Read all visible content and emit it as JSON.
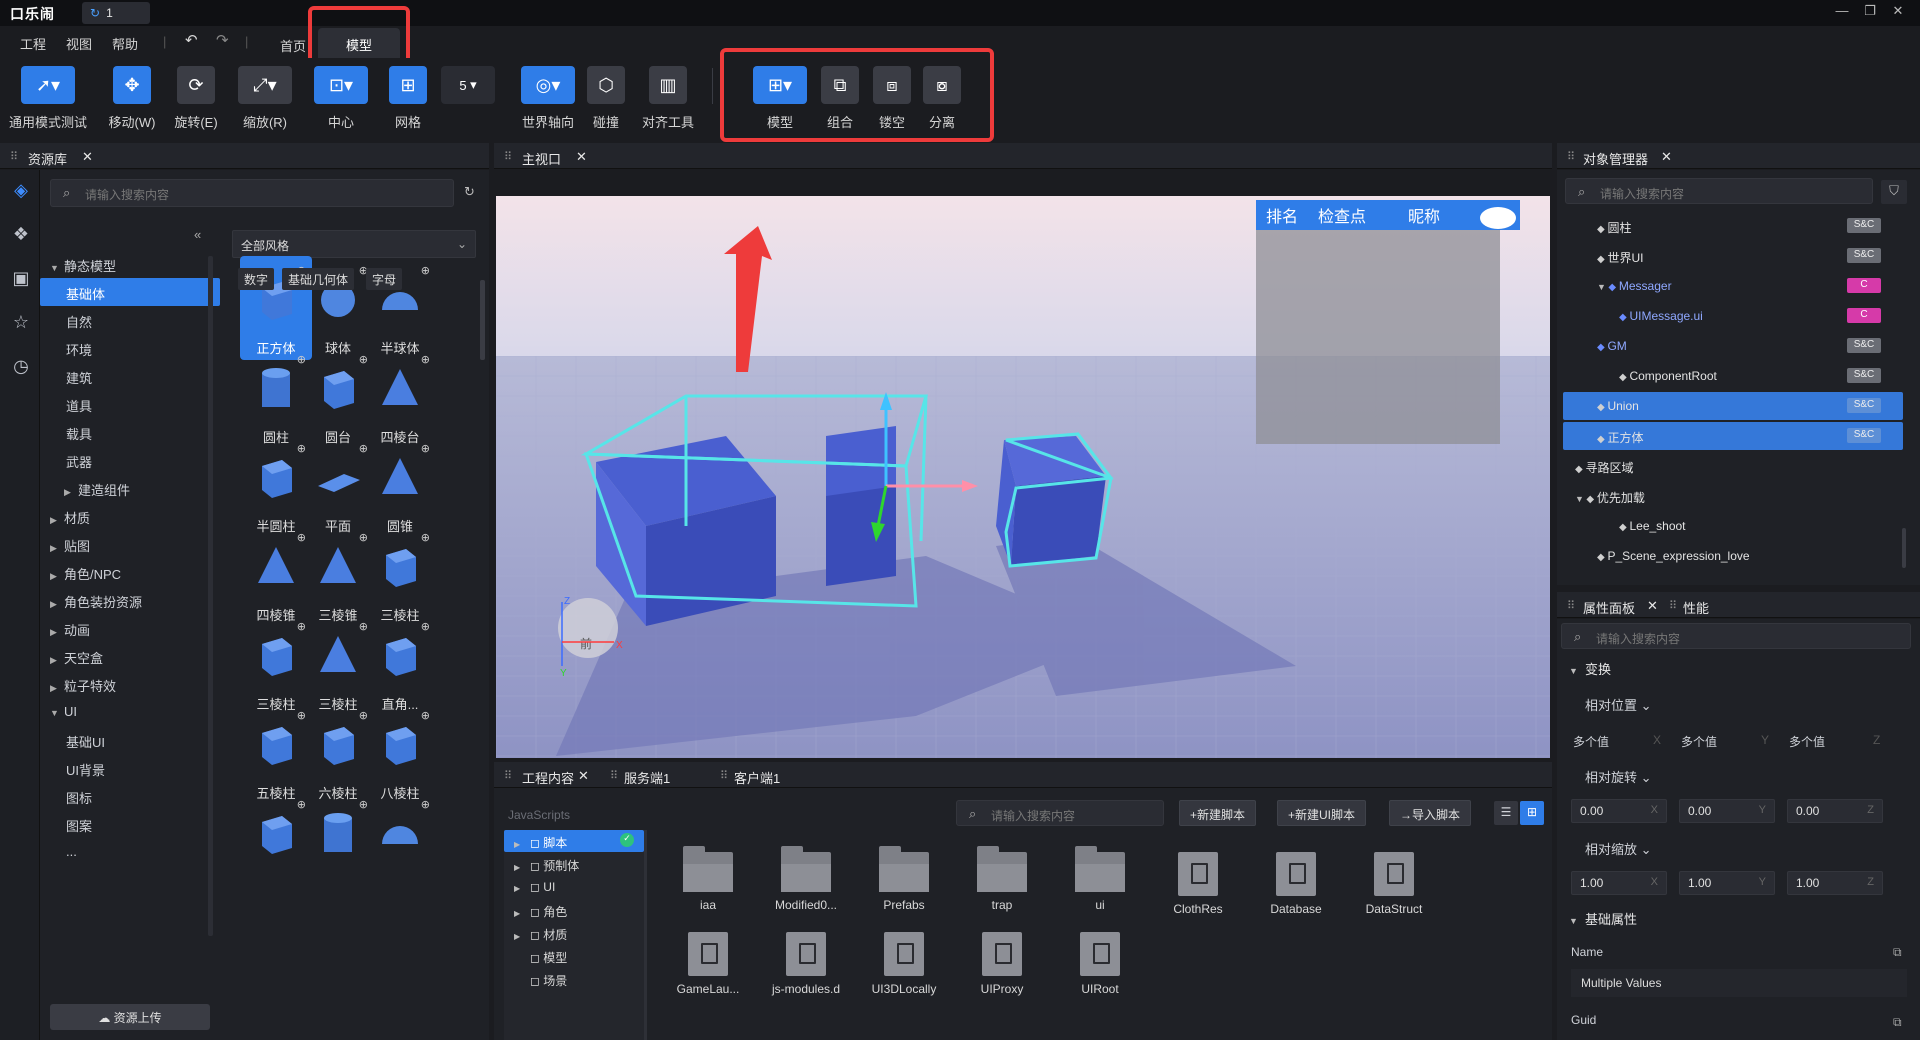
{
  "app": {
    "logo": "口乐闹",
    "doc_tab": "1"
  },
  "menu": {
    "project": "工程",
    "view": "视图",
    "help": "帮助"
  },
  "page_tabs": {
    "home": "首页",
    "model": "模型"
  },
  "toolbar": {
    "select": "通用模式测试",
    "move": "移动(W)",
    "rotate": "旋转(E)",
    "scale": "缩放(R)",
    "center": "中心",
    "grid": "网格",
    "grid_size": "5",
    "world_axis": "世界轴向",
    "collision": "碰撞",
    "align": "对齐工具",
    "model": "模型",
    "combine": "组合",
    "hollow": "镂空",
    "separate": "分离"
  },
  "assets": {
    "title": "资源库",
    "search_placeholder": "请输入搜索内容",
    "style_select": "全部风格",
    "chips": [
      "数字",
      "基础几何体",
      "字母"
    ],
    "tree": [
      {
        "label": "静态模型",
        "caret": "▼"
      },
      {
        "label": "基础体",
        "sel": true
      },
      {
        "label": "自然"
      },
      {
        "label": "环境"
      },
      {
        "label": "建筑"
      },
      {
        "label": "道具"
      },
      {
        "label": "载具"
      },
      {
        "label": "武器"
      },
      {
        "label": "建造组件",
        "caret": "▶"
      },
      {
        "label": "材质",
        "caret": "▶"
      },
      {
        "label": "贴图",
        "caret": "▶"
      },
      {
        "label": "角色/NPC",
        "caret": "▶"
      },
      {
        "label": "角色装扮资源",
        "caret": "▶"
      },
      {
        "label": "动画",
        "caret": "▶"
      },
      {
        "label": "天空盒",
        "caret": "▶"
      },
      {
        "label": "粒子特效",
        "caret": "▶"
      },
      {
        "label": "UI",
        "caret": "▼"
      },
      {
        "label": "基础UI"
      },
      {
        "label": "UI背景"
      },
      {
        "label": "图标"
      },
      {
        "label": "图案"
      },
      {
        "label": "..."
      }
    ],
    "items": [
      "正方体",
      "球体",
      "半球体",
      "圆柱",
      "圆台",
      "四棱台",
      "半圆柱",
      "平面",
      "圆锥",
      "四棱锥",
      "三棱锥",
      "三棱柱",
      "三棱柱",
      "三棱柱",
      "直角...",
      "五棱柱",
      "六棱柱",
      "八棱柱",
      "",
      "",
      ""
    ],
    "upload": "资源上传"
  },
  "viewport": {
    "title": "主视口",
    "leaderboard": {
      "rank": "排名",
      "checkpoint": "检查点",
      "nickname": "昵称"
    },
    "gizmo_front": "前",
    "axis_z": "Z",
    "axis_x": "X",
    "axis_y": "Y"
  },
  "project": {
    "tabs": [
      "工程内容",
      "服务端1",
      "客户端1"
    ],
    "lang": "JavaScripts",
    "search_placeholder": "请输入搜索内容",
    "buttons": {
      "new_script": "+新建脚本",
      "new_ui_script": "+新建UI脚本",
      "import_script": "→导入脚本"
    },
    "tree": [
      "脚本",
      "预制体",
      "UI",
      "角色",
      "材质",
      "模型",
      "场景"
    ],
    "files": [
      {
        "name": "iaa",
        "type": "folder"
      },
      {
        "name": "Modified0...",
        "type": "folder"
      },
      {
        "name": "Prefabs",
        "type": "folder"
      },
      {
        "name": "trap",
        "type": "folder"
      },
      {
        "name": "ui",
        "type": "folder"
      },
      {
        "name": "ClothRes",
        "type": "doc"
      },
      {
        "name": "Database",
        "type": "doc"
      },
      {
        "name": "DataStruct",
        "type": "doc"
      },
      {
        "name": "GameLau...",
        "type": "doc"
      },
      {
        "name": "js-modules.d",
        "type": "doc"
      },
      {
        "name": "UI3DLocally",
        "type": "doc"
      },
      {
        "name": "UIProxy",
        "type": "doc"
      },
      {
        "name": "UIRoot",
        "type": "doc"
      }
    ]
  },
  "outliner": {
    "title": "对象管理器",
    "search_placeholder": "请输入搜索内容",
    "rows": [
      {
        "label": "圆柱",
        "badge": "S&C",
        "indent": 1
      },
      {
        "label": "世界UI",
        "badge": "S&C",
        "indent": 1
      },
      {
        "label": "Messager",
        "badge": "C",
        "indent": 1,
        "caret": "▼",
        "blue": true
      },
      {
        "label": "UIMessage.ui",
        "badge": "C",
        "indent": 2,
        "blue": true
      },
      {
        "label": "GM",
        "badge": "S&C",
        "indent": 1,
        "blue": true
      },
      {
        "label": "ComponentRoot",
        "badge": "S&C",
        "indent": 2
      },
      {
        "label": "Union",
        "badge": "S&C",
        "indent": 1,
        "sel": true
      },
      {
        "label": "正方体",
        "badge": "S&C",
        "indent": 1,
        "sel": true
      },
      {
        "label": "寻路区域",
        "badge": "",
        "indent": 0
      },
      {
        "label": "优先加载",
        "badge": "",
        "indent": 0,
        "caret": "▼"
      },
      {
        "label": "Lee_shoot",
        "badge": "",
        "indent": 2
      },
      {
        "label": "P_Scene_expression_love",
        "badge": "",
        "indent": 1
      }
    ]
  },
  "props": {
    "tab_props": "属性面板",
    "tab_perf": "性能",
    "search_placeholder": "请输入搜索内容",
    "transform": "变换",
    "rel_pos": "相对位置",
    "multi": "多个值",
    "rel_rot": "相对旋转",
    "rel_scale": "相对缩放",
    "rot": [
      "0.00",
      "0.00",
      "0.00"
    ],
    "scale": [
      "1.00",
      "1.00",
      "1.00"
    ],
    "basic": "基础属性",
    "name_label": "Name",
    "name_value": "Multiple Values",
    "guid_label": "Guid",
    "axes": [
      "X",
      "Y",
      "Z"
    ]
  }
}
